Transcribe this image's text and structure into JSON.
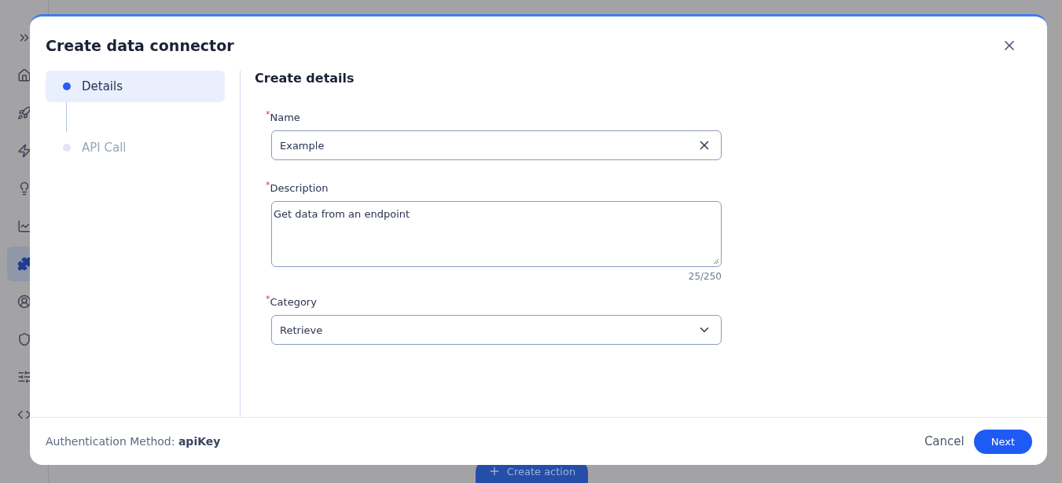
{
  "sidebar": {
    "items": [
      {
        "kind": "expand",
        "selected": false
      },
      {
        "kind": "home",
        "selected": false
      },
      {
        "kind": "rocket",
        "selected": false
      },
      {
        "kind": "zap",
        "selected": false
      },
      {
        "kind": "bulb",
        "selected": false
      },
      {
        "kind": "chart",
        "selected": false
      },
      {
        "kind": "puzzle",
        "selected": true
      },
      {
        "kind": "user",
        "selected": false
      },
      {
        "kind": "shield",
        "selected": false
      },
      {
        "kind": "sliders",
        "selected": false
      },
      {
        "kind": "code",
        "selected": false
      }
    ]
  },
  "background_button": {
    "label": "Create action"
  },
  "dialog": {
    "title": "Create data connector",
    "steps": [
      {
        "label": "Details",
        "selected": true
      },
      {
        "label": "API Call",
        "selected": false
      }
    ],
    "section_title": "Create details",
    "fields": [
      {
        "kind": "text",
        "label": "Name",
        "required_mark": "*",
        "value": "Example"
      },
      {
        "kind": "textarea",
        "label": "Description",
        "required_mark": "*",
        "value": "Get data from an endpoint",
        "counter": "25/250"
      },
      {
        "kind": "select",
        "label": "Category",
        "required_mark": "*",
        "value": "Retrieve"
      }
    ],
    "footer": {
      "text": "Authentication Method: **apiKey**",
      "buttons": [
        {
          "label": "Cancel",
          "kind": "secondary"
        },
        {
          "label": "Next",
          "kind": "primary"
        }
      ]
    }
  }
}
